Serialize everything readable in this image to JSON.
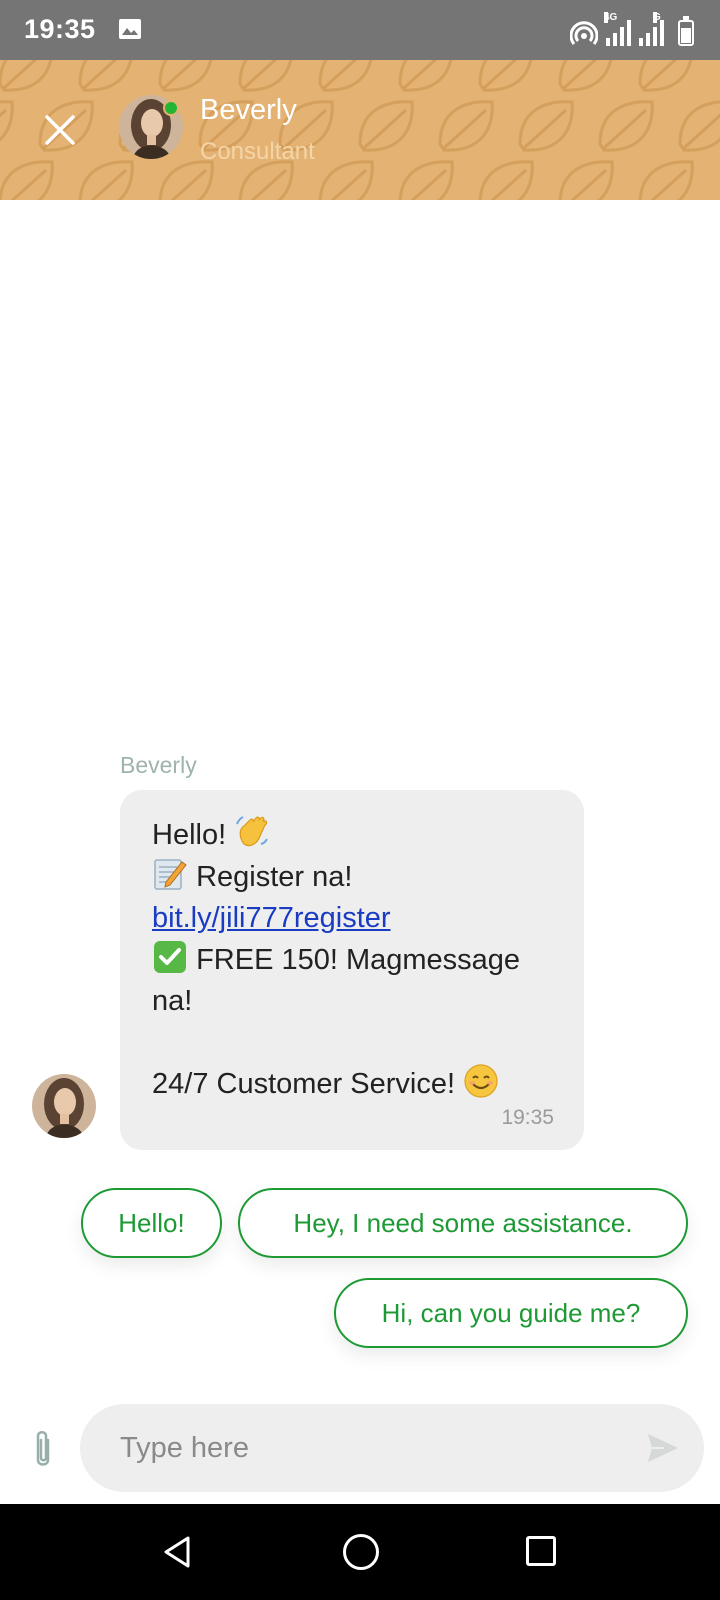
{
  "status_bar": {
    "time": "19:35",
    "icons": [
      "gallery-icon",
      "hotspot-icon",
      "signal-4g-icon",
      "signal-g-icon",
      "battery-icon"
    ],
    "network_labels": [
      "4G",
      "G"
    ]
  },
  "header": {
    "agent_name": "Beverly",
    "agent_role": "Consultant",
    "online": true,
    "colors": {
      "background": "#e4b273",
      "online": "#25b535"
    }
  },
  "message": {
    "sender": "Beverly",
    "lines": {
      "greeting": "Hello!",
      "register": "Register na!",
      "link": "bit.ly/jili777register",
      "free": "FREE 150! Magmessage",
      "free_cont": "na!",
      "service": "24/7 Customer Service!"
    },
    "emojis": [
      "waving-hand",
      "memo",
      "check-mark-button",
      "smiling-face"
    ],
    "time": "19:35"
  },
  "quick_replies": [
    "Hello!",
    "Hey, I need some assistance.",
    "Hi, can you guide me?"
  ],
  "composer": {
    "placeholder": "Type here"
  },
  "colors": {
    "accent": "#1e9a35",
    "link": "#1a3cc2",
    "bubble": "#eeeeee"
  }
}
